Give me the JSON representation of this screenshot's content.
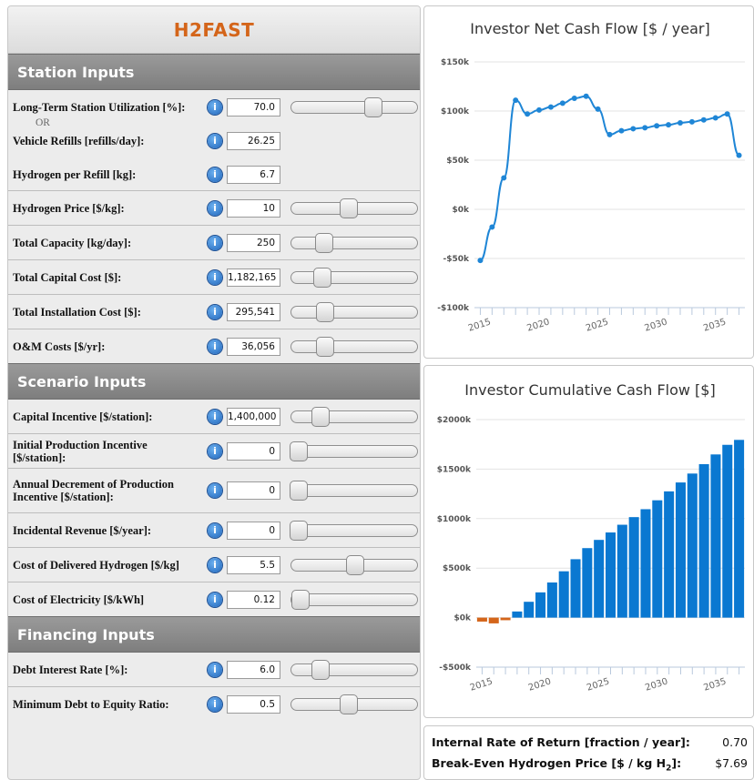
{
  "app": {
    "title": "H2FAST"
  },
  "sections": {
    "station": "Station Inputs",
    "scenario": "Scenario Inputs",
    "financing": "Financing Inputs"
  },
  "inputs": {
    "utilization": {
      "label": "Long-Term Station Utilization [%]:",
      "value": "70.0",
      "slider": 0.68,
      "or": "OR"
    },
    "refills": {
      "label": "Vehicle Refills [refills/day]:",
      "value": "26.25"
    },
    "per_refill": {
      "label": "Hydrogen per Refill [kg]:",
      "value": "6.7"
    },
    "price": {
      "label": "Hydrogen Price [$/kg]:",
      "value": "10",
      "slider": 0.46
    },
    "capacity": {
      "label": "Total Capacity [kg/day]:",
      "value": "250",
      "slider": 0.23
    },
    "capital_cost": {
      "label": "Total Capital Cost [$]:",
      "value": "1,182,165",
      "slider": 0.22
    },
    "install_cost": {
      "label": "Total Installation Cost [$]:",
      "value": "295,541",
      "slider": 0.24
    },
    "om_costs": {
      "label": "O&M Costs [$/yr]:",
      "value": "36,056",
      "slider": 0.24
    },
    "capital_incentive": {
      "label": "Capital Incentive [$/station]:",
      "value": "1,400,000",
      "slider": 0.2
    },
    "prod_incentive": {
      "label": "Initial Production Incentive [$/station]:",
      "value": "0",
      "slider": 0.0
    },
    "decrement": {
      "label": "Annual Decrement of Production Incentive [$/station]:",
      "value": "0",
      "slider": 0.0
    },
    "incidental": {
      "label": "Incidental Revenue [$/year]:",
      "value": "0",
      "slider": 0.0
    },
    "delivered_h2": {
      "label": "Cost of Delivered Hydrogen [$/kg]",
      "value": "5.5",
      "slider": 0.52
    },
    "electricity": {
      "label": "Cost of Electricity [$/kWh]",
      "value": "0.12",
      "slider": 0.02
    },
    "debt_rate": {
      "label": "Debt Interest Rate [%]:",
      "value": "6.0",
      "slider": 0.2
    },
    "debt_equity": {
      "label": "Minimum Debt to Equity Ratio:",
      "value": "0.5",
      "slider": 0.46
    }
  },
  "info_glyph": "i",
  "results": {
    "irr_label": "Internal Rate of Return [fraction / year]:",
    "irr_value": "0.70",
    "breakeven_label": "Break-Even Hydrogen Price [$ / kg H",
    "breakeven_sub": "2",
    "breakeven_close": "]:",
    "breakeven_value": "$7.69"
  },
  "colors": {
    "accent": "#d4651a",
    "line": "#1f86d6",
    "bar_pos": "#0a78d1",
    "bar_neg": "#d4651a"
  },
  "chart_data": [
    {
      "type": "line",
      "title": "Investor Net Cash Flow [$ / year]",
      "x": [
        2015,
        2016,
        2017,
        2018,
        2019,
        2020,
        2021,
        2022,
        2023,
        2024,
        2025,
        2026,
        2027,
        2028,
        2029,
        2030,
        2031,
        2032,
        2033,
        2034,
        2035,
        2036,
        2037
      ],
      "series": [
        {
          "values": [
            -52000,
            -18000,
            32000,
            111000,
            97000,
            101000,
            104000,
            108000,
            113000,
            115000,
            102000,
            76000,
            80000,
            82000,
            83000,
            85000,
            86000,
            88000,
            89000,
            91000,
            93000,
            97000,
            55000
          ]
        }
      ],
      "yticks": [
        "$150k",
        "$100k",
        "$50k",
        "$0k",
        "-$50k",
        "-$100k"
      ],
      "xticks": [
        "2015",
        "2020",
        "2025",
        "2030",
        "2035"
      ],
      "ylim": [
        -100000,
        150000
      ],
      "grid": true,
      "legend": "none"
    },
    {
      "type": "bar",
      "title": "Investor Cumulative Cash Flow [$]",
      "x": [
        2015,
        2016,
        2017,
        2018,
        2019,
        2020,
        2021,
        2022,
        2023,
        2024,
        2025,
        2026,
        2027,
        2028,
        2029,
        2030,
        2031,
        2032,
        2033,
        2034,
        2035,
        2036,
        2037
      ],
      "values": [
        -40000,
        -58000,
        -26000,
        62000,
        160000,
        255000,
        355000,
        468000,
        590000,
        702000,
        785000,
        860000,
        938000,
        1015000,
        1095000,
        1185000,
        1275000,
        1365000,
        1455000,
        1550000,
        1648000,
        1745000,
        1795000
      ],
      "yticks": [
        "$2000k",
        "$1500k",
        "$1000k",
        "$500k",
        "$0k",
        "-$500k"
      ],
      "xticks": [
        "2015",
        "2020",
        "2025",
        "2030",
        "2035"
      ],
      "ylim": [
        -500000,
        2000000
      ],
      "grid": true,
      "legend": "none"
    }
  ]
}
